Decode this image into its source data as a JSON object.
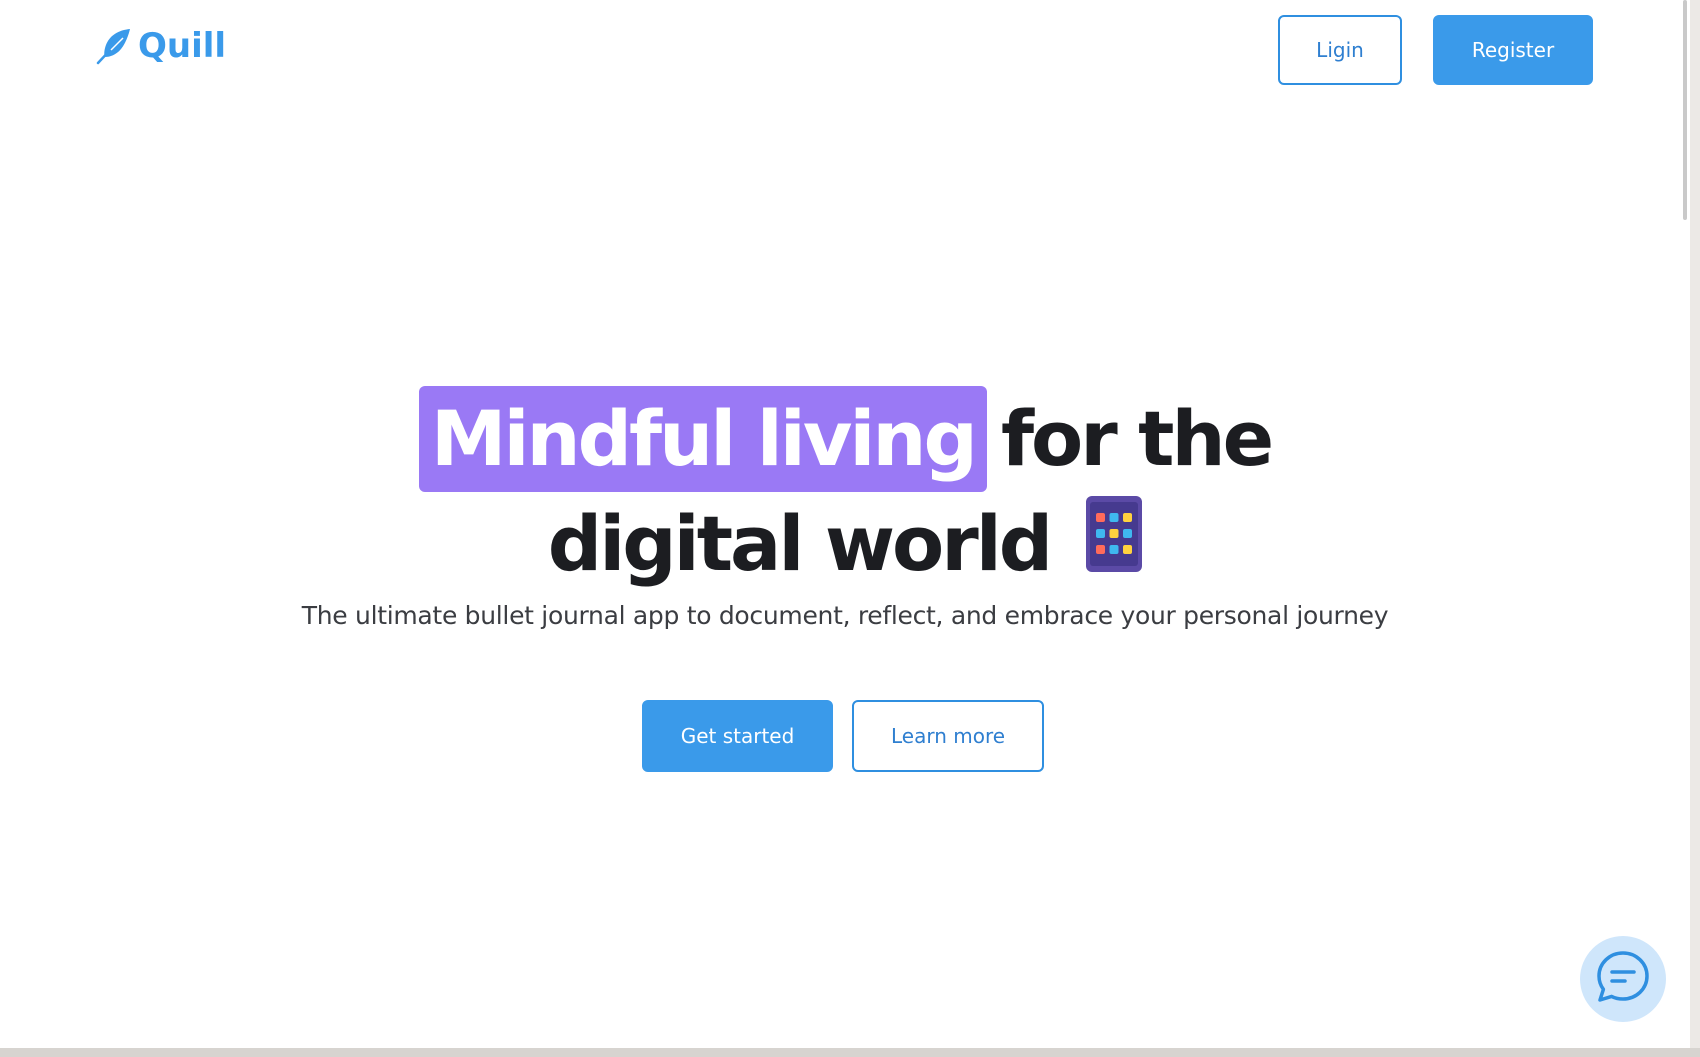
{
  "header": {
    "logo_text": "Quill",
    "login_label": "Ligin",
    "register_label": "Register"
  },
  "hero": {
    "highlight_text": "Mindful living",
    "line1_rest": "for the",
    "line2": "digital world",
    "subtitle": "The ultimate bullet journal app to document, reflect, and embrace your personal journey",
    "primary_cta": "Get started",
    "secondary_cta": "Learn more"
  },
  "icons": {
    "logo": "feather-icon",
    "hero": "tablet-app-grid-icon",
    "chat": "chat-bubble-icon"
  },
  "colors": {
    "brand": "#3a9aea",
    "highlight": "#9a79f5",
    "heading": "#1c1d21",
    "chat_bg": "#cfe6fb"
  }
}
